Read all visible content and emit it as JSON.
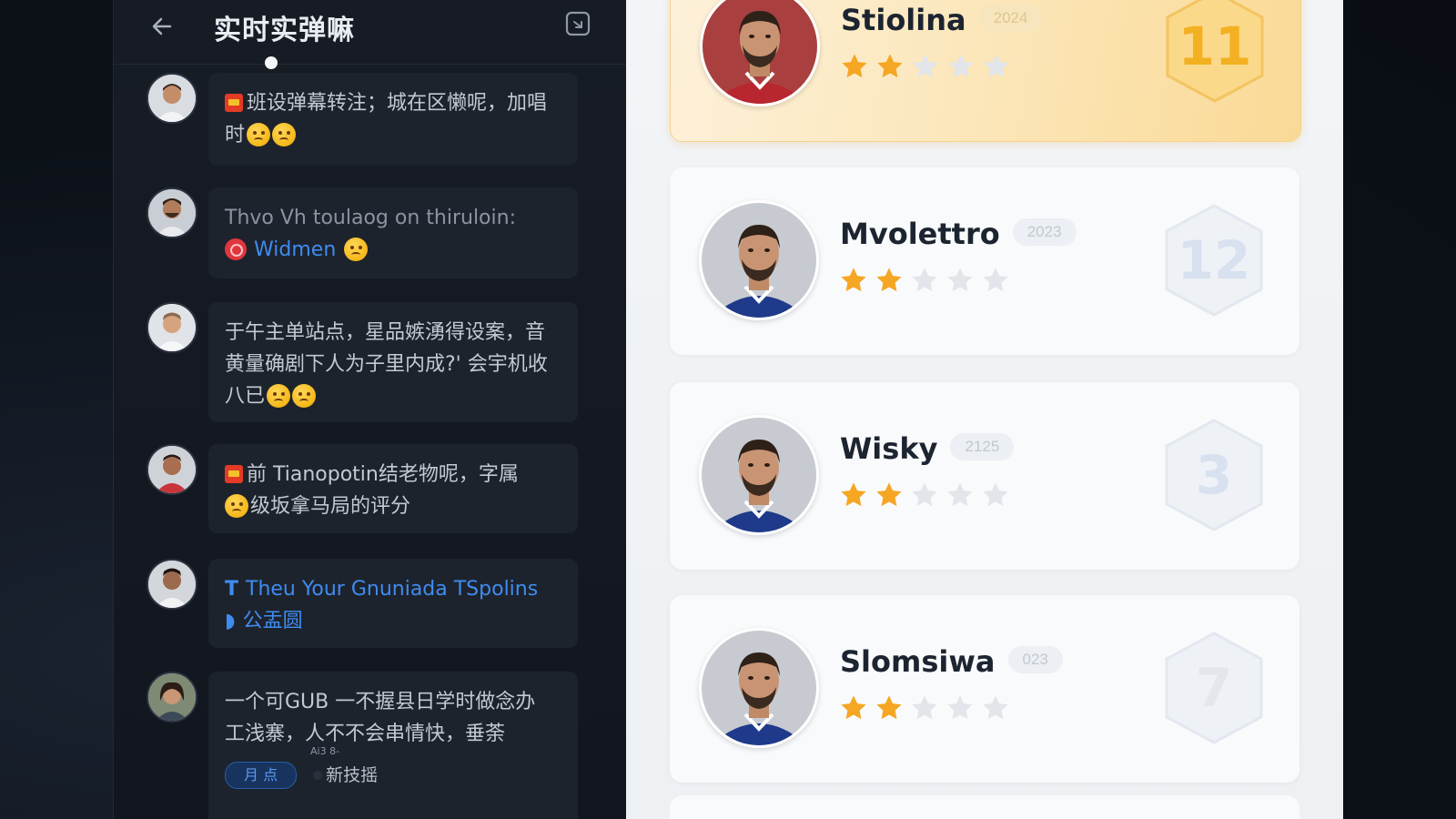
{
  "chat": {
    "title": "实时实弹嘛",
    "messages": [
      {
        "prefix_flag": true,
        "lines": [
          "班设弹幕转注；城在区懒呢，加唱",
          "时"
        ],
        "emojis": 2
      },
      {
        "lines": [
          "Thvo Vh toulaog on thiruloin:"
        ],
        "badge_text": "Widmen",
        "emojis": 1
      },
      {
        "lines": [
          "于午主单站点，星品嫉湧得设案，音",
          "黄量确剧下人为子里内成?' 会宇机收",
          "八已"
        ],
        "emojis": 2
      },
      {
        "prefix_flag": true,
        "lines": [
          "前 Tianopotin结老物呢，字属",
          "级坂拿马局的评分"
        ],
        "emojis": 1
      },
      {
        "lines": [
          "Theu Your Gnuniada TSpolins",
          "公盂圆"
        ],
        "glyph": "T"
      },
      {
        "lines": [
          "一个可GUB 一不握县日学时做念办",
          "工浅寨，人不不会串情快，垂荼"
        ],
        "chip_label": "月 点",
        "chip_sup": "Ai3 8-",
        "chip_text": "新技摇"
      }
    ]
  },
  "players": [
    {
      "name": "Stiolina",
      "year": "2024",
      "rating": 2,
      "max_rating": 5,
      "number": "11",
      "highlight": true,
      "kit": "#b8262f"
    },
    {
      "name": "Mvolettro",
      "year": "2023",
      "rating": 2,
      "max_rating": 5,
      "number": "12",
      "highlight": false,
      "kit": "#1f3a8a"
    },
    {
      "name": "Wisky",
      "year": "2125",
      "rating": 2,
      "max_rating": 5,
      "number": "3",
      "highlight": false,
      "kit": "#1f3a8a"
    },
    {
      "name": "Slomsiwa",
      "year": "023",
      "rating": 2,
      "max_rating": 5,
      "number": "7",
      "highlight": false,
      "kit": "#1f3a8a"
    }
  ],
  "colors": {
    "accent_blue": "#3f8cf0",
    "star_filled": "#f5a623",
    "star_empty": "#e2e5ea",
    "highlight_gold": "#f5b72c"
  },
  "icons": [
    "back-arrow-icon",
    "share-icon",
    "star-icon",
    "hexagon-badge-icon",
    "red-badge-icon",
    "flag-icon",
    "emoji-icon"
  ]
}
